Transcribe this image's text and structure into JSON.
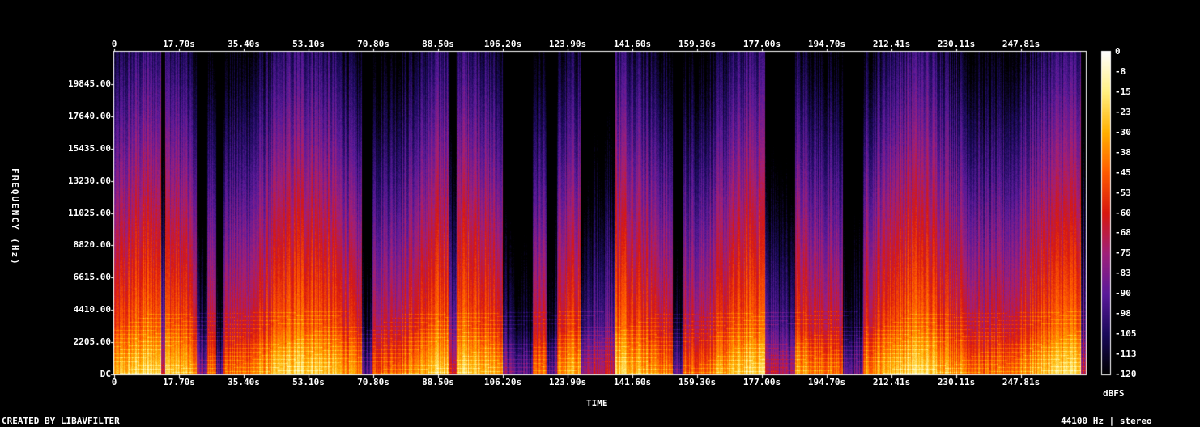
{
  "chart_data": {
    "type": "heatmap",
    "title": "",
    "xlabel": "TIME",
    "ylabel": "FREQUENCY (Hz)",
    "x_ticks": [
      "0",
      "17.70s",
      "35.40s",
      "53.10s",
      "70.80s",
      "88.50s",
      "106.20s",
      "123.90s",
      "141.60s",
      "159.30s",
      "177.00s",
      "194.70s",
      "212.41s",
      "230.11s",
      "247.81s"
    ],
    "x_tick_values": [
      0,
      17.7,
      35.4,
      53.1,
      70.8,
      88.5,
      106.2,
      123.9,
      141.6,
      159.3,
      177.0,
      194.7,
      212.41,
      230.11,
      247.81
    ],
    "xlim": [
      0,
      265.5
    ],
    "y_ticks": [
      "DC",
      "2205.00",
      "4410.00",
      "6615.00",
      "8820.00",
      "11025.00",
      "13230.00",
      "15435.00",
      "17640.00",
      "19845.00"
    ],
    "y_tick_values": [
      0,
      2205,
      4410,
      6615,
      8820,
      11025,
      13230,
      15435,
      17640,
      19845
    ],
    "ylim": [
      0,
      22050
    ],
    "colorbar": {
      "label": "dBFS",
      "ticks": [
        "0",
        "-8",
        "-15",
        "-23",
        "-30",
        "-38",
        "-45",
        "-53",
        "-60",
        "-68",
        "-75",
        "-83",
        "-90",
        "-98",
        "-105",
        "-113",
        "-120"
      ],
      "range": [
        -120,
        0
      ]
    },
    "colors": [
      "#000000",
      "#1a0a5a",
      "#5a1a9a",
      "#a0207a",
      "#d8180f",
      "#ff5a00",
      "#ffb000",
      "#fff080",
      "#ffffff"
    ]
  },
  "footer": {
    "credit": "CREATED BY LIBAVFILTER",
    "info": "44100 Hz | stereo"
  }
}
